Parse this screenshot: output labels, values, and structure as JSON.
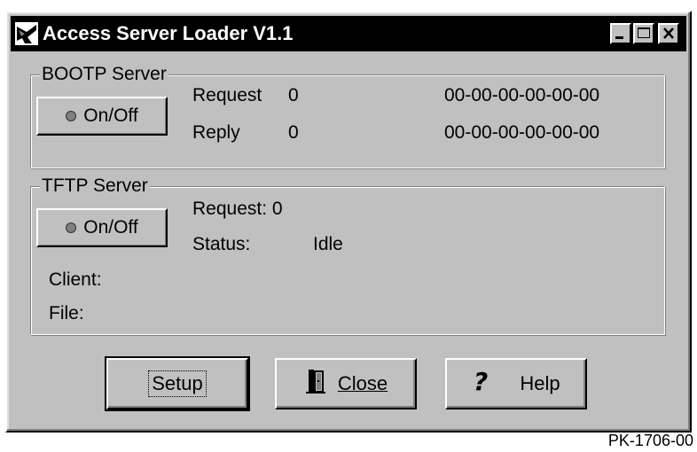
{
  "window": {
    "title": "Access Server Loader V1.1"
  },
  "bootp": {
    "legend": "BOOTP Server",
    "onoff_label": "On/Off",
    "request_label": "Request",
    "request_value": "0",
    "request_mac": "00-00-00-00-00-00",
    "reply_label": "Reply",
    "reply_value": "0",
    "reply_mac": "00-00-00-00-00-00"
  },
  "tftp": {
    "legend": "TFTP Server",
    "onoff_label": "On/Off",
    "request_label": "Request: 0",
    "status_label": "Status:",
    "status_value": "Idle",
    "client_label": "Client:",
    "file_label": "File:"
  },
  "buttons": {
    "setup": "Setup",
    "close": "Close",
    "help": "Help"
  },
  "figure_code": "PK-1706-00",
  "icons": {
    "app": "network-card-icon",
    "minimize": "minimize-icon",
    "maximize": "maximize-icon",
    "close": "close-icon",
    "led": "led-indicator-icon",
    "door": "door-exit-icon",
    "help": "question-mark-icon"
  }
}
